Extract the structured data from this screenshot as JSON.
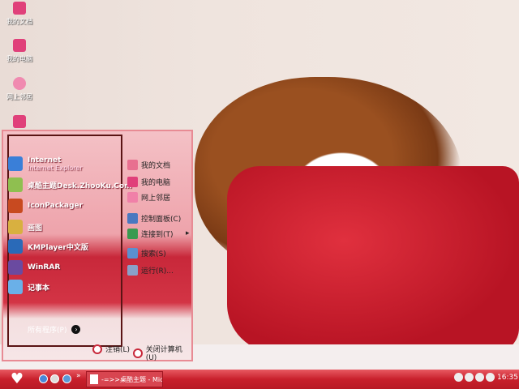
{
  "desktop": {
    "icons": [
      {
        "label": "我的文档",
        "icon": "documents-icon"
      },
      {
        "label": "我的电脑",
        "icon": "computer-icon"
      },
      {
        "label": "网上邻居",
        "icon": "network-icon"
      }
    ]
  },
  "start_menu": {
    "pinned": [
      {
        "label": "Internet",
        "sub": "Internet Explorer",
        "color": "#3a7fd8"
      },
      {
        "label": "桌酷主题Desk.ZhooKu.Com",
        "color": "#8fbf50"
      },
      {
        "label": "IconPackager",
        "color": "#c84a20"
      },
      {
        "label": "画图",
        "color": "#d8b040"
      },
      {
        "label": "KMPlayer中文版",
        "color": "#2a6ab8"
      },
      {
        "label": "WinRAR",
        "color": "#6a4aa0"
      },
      {
        "label": "记事本",
        "color": "#6ab0e8"
      }
    ],
    "all_programs": "所有程序(P)",
    "places": [
      {
        "label": "我的文档",
        "color": "#e87090"
      },
      {
        "label": "我的电脑",
        "color": "#e0407a"
      },
      {
        "label": "网上邻居",
        "color": "#f080a8"
      },
      {
        "label": "控制面板(C)",
        "color": "#4a78c0"
      },
      {
        "label": "连接到(T)",
        "color": "#3a9a50",
        "arrow": "▸"
      },
      {
        "label": "搜索(S)",
        "color": "#5a90d0"
      },
      {
        "label": "运行(R)...",
        "color": "#8aa0c8"
      }
    ],
    "logoff": "注销(L)",
    "shutdown": "关闭计算机(U)"
  },
  "taskbar": {
    "start_glyph": "♥",
    "quicklaunch_more": "»",
    "task": "-=>>桌酷主题 - Mic...",
    "clock": "16:35"
  }
}
